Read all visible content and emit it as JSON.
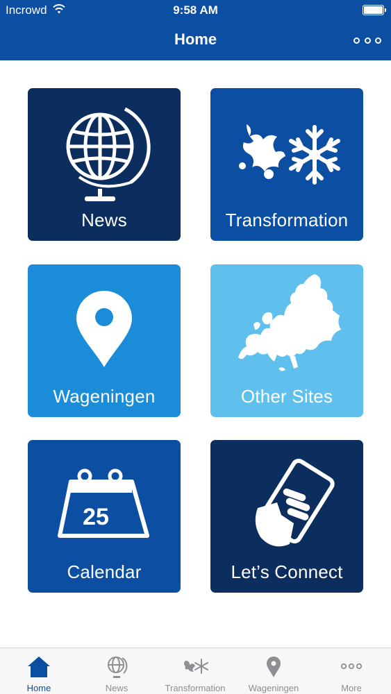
{
  "status_bar": {
    "carrier": "Incrowd",
    "time": "9:58 AM"
  },
  "nav_bar": {
    "title": "Home",
    "more_icon": "more-dots-icon"
  },
  "tiles": [
    {
      "label": "News",
      "icon": "globe-icon",
      "color": "#0c2e5e"
    },
    {
      "label": "Transformation",
      "icon": "flourish-snowflake-icon",
      "color": "#0b4ea2"
    },
    {
      "label": "Wageningen",
      "icon": "map-pin-icon",
      "color": "#1a8cd8"
    },
    {
      "label": "Other Sites",
      "icon": "europe-map-icon",
      "color": "#5fc0ee"
    },
    {
      "label": "Calendar",
      "icon": "calendar-icon",
      "calendar_day": "25",
      "color": "#0b4ea2"
    },
    {
      "label": "Let’s Connect",
      "icon": "phone-in-hand-icon",
      "color": "#0c2e5e"
    }
  ],
  "tab_bar": {
    "items": [
      {
        "label": "Home",
        "icon": "home-icon",
        "active": true
      },
      {
        "label": "News",
        "icon": "globe-icon",
        "active": false
      },
      {
        "label": "Transformation",
        "icon": "flourish-snowflake-icon",
        "active": false
      },
      {
        "label": "Wageningen",
        "icon": "map-pin-icon",
        "active": false
      },
      {
        "label": "More",
        "icon": "more-dots-icon",
        "active": false
      }
    ]
  },
  "colors": {
    "brand_blue": "#0b4ea2",
    "navy": "#0c2e5e",
    "sky": "#1a8cd8",
    "light_sky": "#5fc0ee",
    "tab_inactive": "#8e8e93"
  }
}
